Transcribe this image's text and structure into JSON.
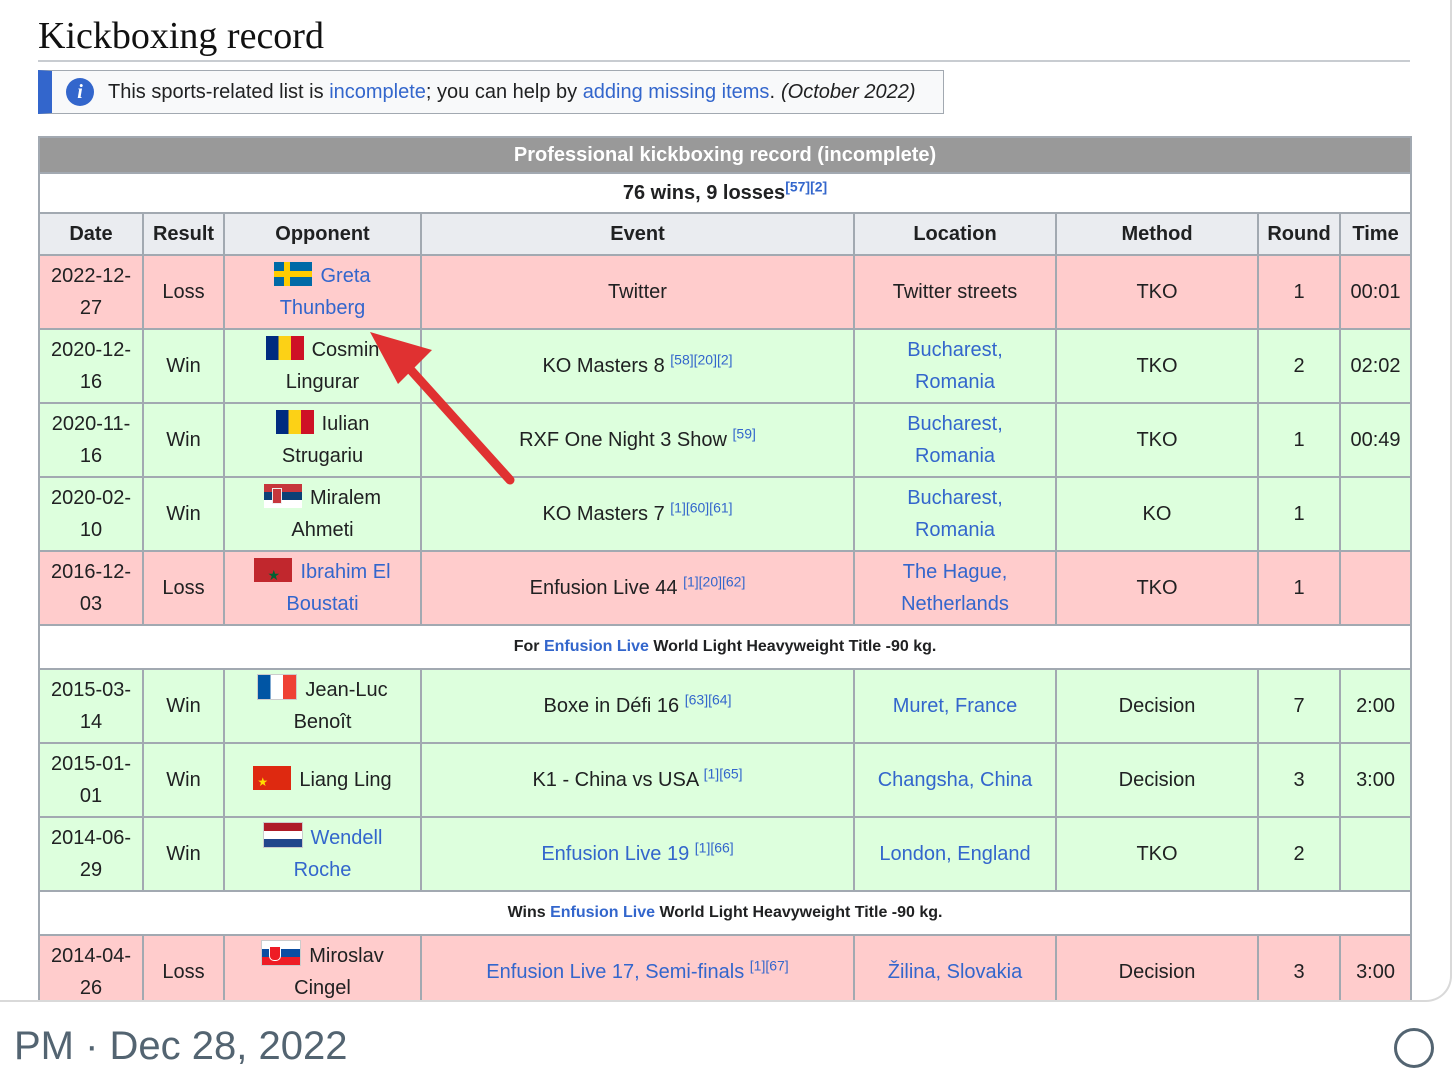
{
  "section_heading": "Kickboxing record",
  "notice": {
    "icon": "info-icon",
    "text_before": "This sports-related list is",
    "link_incomplete": "incomplete",
    "text_middle": "; you can help by",
    "link_adding": "adding missing items",
    "text_end": ".",
    "date": "(October 2022)"
  },
  "table": {
    "caption": "Professional kickboxing record (incomplete)",
    "summary": "76 wins, 9 losses",
    "summary_refs": "[57][2]",
    "headers": [
      "Date",
      "Result",
      "Opponent",
      "Event",
      "Location",
      "Method",
      "Round",
      "Time"
    ],
    "rows": [
      {
        "date1": "2022-12-",
        "date2": "27",
        "result": "Loss",
        "flag": "sweden",
        "opp1": "Greta",
        "opp2": "Thunberg",
        "opp_link": true,
        "event": "Twitter",
        "event_refs": "",
        "event_link": false,
        "location1": "Twitter streets",
        "location2": "",
        "location_link": false,
        "method": "TKO",
        "round": "1",
        "time": "00:01"
      },
      {
        "date1": "2020-12-",
        "date2": "16",
        "result": "Win",
        "flag": "romania",
        "opp1": "Cosmin",
        "opp2": "Lingurar",
        "opp_link": false,
        "event": "KO Masters 8",
        "event_refs": "[58][20][2]",
        "event_link": false,
        "location1": "Bucharest,",
        "location2": "Romania",
        "location_link": true,
        "method": "TKO",
        "round": "2",
        "time": "02:02"
      },
      {
        "date1": "2020-11-",
        "date2": "16",
        "result": "Win",
        "flag": "romania",
        "opp1": "Iulian",
        "opp2": "Strugariu",
        "opp_link": false,
        "event": "RXF One Night 3 Show",
        "event_refs": "[59]",
        "event_link": false,
        "location1": "Bucharest,",
        "location2": "Romania",
        "location_link": true,
        "method": "TKO",
        "round": "1",
        "time": "00:49"
      },
      {
        "date1": "2020-02-",
        "date2": "10",
        "result": "Win",
        "flag": "serbia",
        "opp1": "Miralem",
        "opp2": "Ahmeti",
        "opp_link": false,
        "event": "KO Masters 7",
        "event_refs": "[1][60][61]",
        "event_link": false,
        "location1": "Bucharest,",
        "location2": "Romania",
        "location_link": true,
        "method": "KO",
        "round": "1",
        "time": ""
      },
      {
        "date1": "2016-12-",
        "date2": "03",
        "result": "Loss",
        "flag": "morocco",
        "opp1": "Ibrahim El",
        "opp2": "Boustati",
        "opp_link": true,
        "event": "Enfusion Live 44",
        "event_refs": "[1][20][62]",
        "event_link": false,
        "location1": "The Hague,",
        "location2": "Netherlands",
        "location_link": true,
        "method": "TKO",
        "round": "1",
        "time": ""
      },
      {
        "date1": "2015-03-",
        "date2": "14",
        "result": "Win",
        "flag": "france",
        "opp1": "Jean-Luc",
        "opp2": "Benoît",
        "opp_link": false,
        "event": "Boxe in Défi 16",
        "event_refs": "[63][64]",
        "event_link": false,
        "location1": "Muret, France",
        "location2": "",
        "location_link": true,
        "method": "Decision",
        "round": "7",
        "time": "2:00"
      },
      {
        "date1": "2015-01-",
        "date2": "01",
        "result": "Win",
        "flag": "china",
        "opp1": "Liang Ling",
        "opp2": "",
        "opp_link": false,
        "event": "K1 - China vs USA",
        "event_refs": "[1][65]",
        "event_link": false,
        "location1": "Changsha, China",
        "location2": "",
        "location_link": true,
        "method": "Decision",
        "round": "3",
        "time": "3:00"
      },
      {
        "date1": "2014-06-",
        "date2": "29",
        "result": "Win",
        "flag": "netherlands",
        "opp1": "Wendell",
        "opp2": "Roche",
        "opp_link": true,
        "event": "Enfusion Live 19",
        "event_refs": "[1][66]",
        "event_link": true,
        "location1": "London, England",
        "location2": "",
        "location_link": true,
        "method": "TKO",
        "round": "2",
        "time": ""
      },
      {
        "date1": "2014-04-",
        "date2": "26",
        "result": "Loss",
        "flag": "slovakia",
        "opp1": "Miroslav",
        "opp2": "Cingel",
        "opp_link": false,
        "event": "Enfusion Live 17, Semi-finals",
        "event_refs": "[1][67]",
        "event_link": true,
        "location1": "Žilina, Slovakia",
        "location2": "",
        "location_link": true,
        "method": "Decision",
        "round": "3",
        "time": "3:00"
      }
    ],
    "notes": [
      {
        "prefix": "For",
        "link": "Enfusion Live",
        "suffix": "World Light Heavyweight Title -90 kg."
      },
      {
        "prefix": "Wins",
        "link": "Enfusion Live",
        "suffix": "World Light Heavyweight Title -90 kg."
      }
    ]
  },
  "annotation": {
    "color": "#e03131"
  },
  "footer": {
    "timestamp": "PM · Dec 28, 2022",
    "icon": "info-icon"
  },
  "colors": {
    "win_row": "#ddffdd",
    "loss_row": "#ffcccc",
    "link": "#3366cc",
    "caption_bg": "#999999"
  }
}
